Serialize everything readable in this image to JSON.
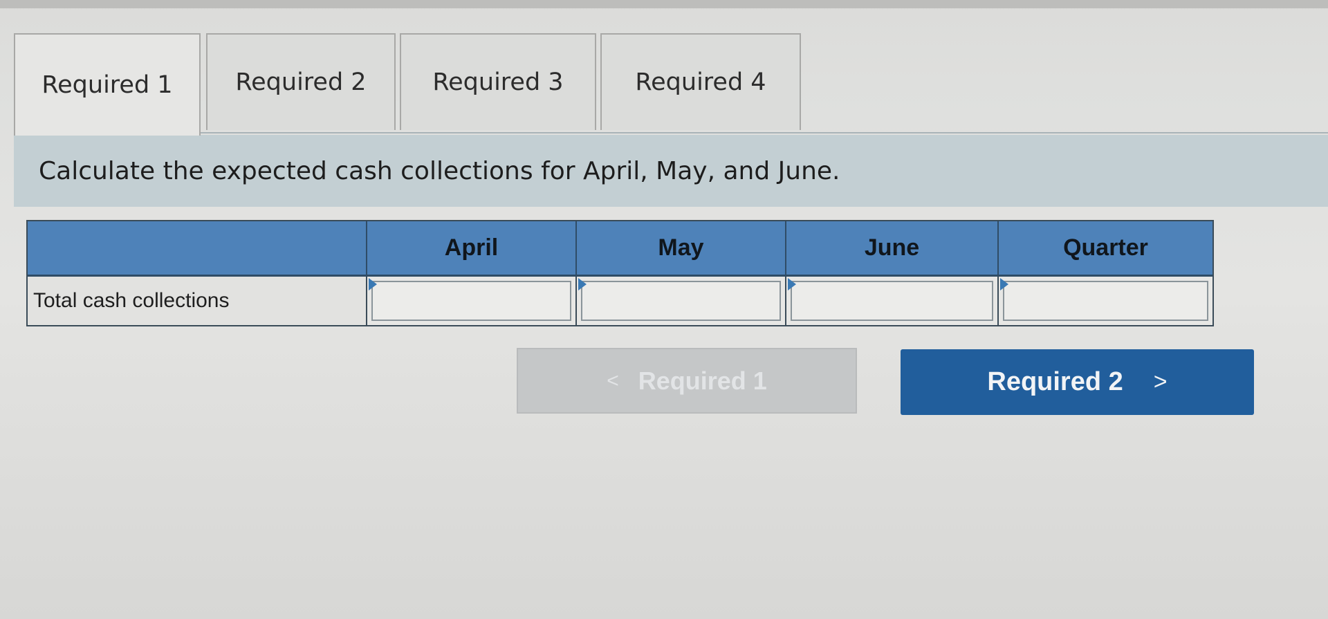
{
  "tabs": [
    {
      "label": "Required 1",
      "active": true
    },
    {
      "label": "Required 2",
      "active": false
    },
    {
      "label": "Required 3",
      "active": false
    },
    {
      "label": "Required 4",
      "active": false
    }
  ],
  "instruction": "Calculate the expected cash collections for April, May, and June.",
  "table": {
    "columns": [
      "",
      "April",
      "May",
      "June",
      "Quarter"
    ],
    "rows": [
      {
        "label": "Total cash collections",
        "values": [
          "",
          "",
          "",
          ""
        ]
      }
    ]
  },
  "navigation": {
    "prev_label": "Required 1",
    "prev_enabled": false,
    "prev_icon": "chevron-left-icon",
    "next_label": "Required 2",
    "next_enabled": true,
    "next_icon": "chevron-right-icon"
  },
  "colors": {
    "header_blue": "#4e82b9",
    "next_button": "#215e9c",
    "banner": "#c3cfd3"
  }
}
